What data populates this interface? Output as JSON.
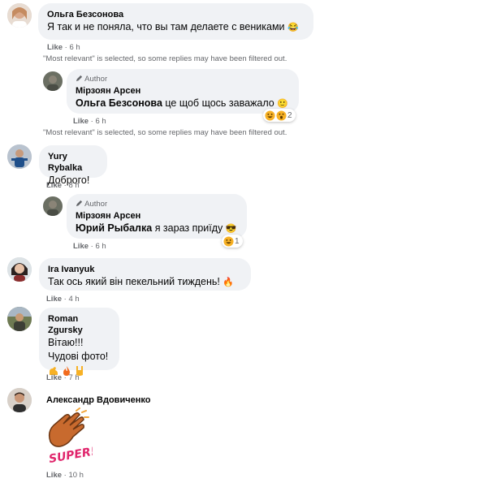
{
  "comments": [
    {
      "name": "Ольга Безсонова",
      "text": "Я так и не поняла, что вы там делаете с вениками",
      "emoji": "😂",
      "like": "Like",
      "time": "6 h"
    },
    {
      "note": "\"Most relevant\" is selected, so some replies may have been filtered out."
    },
    {
      "author_badge": "Author",
      "name": "Мірзоян Арсен",
      "mention": "Ольга Безсонова",
      "text": "це щоб щось заважало",
      "emoji": "🙂",
      "reaction_count": "2",
      "like": "Like",
      "time": "6 h"
    },
    {
      "note": "\"Most relevant\" is selected, so some replies may have been filtered out."
    },
    {
      "name": "Yury Rybalka",
      "text": "Доброго!",
      "like": "Like",
      "time": "8 h"
    },
    {
      "author_badge": "Author",
      "name": "Мірзоян Арсен",
      "mention": "Юрий Рыбалка",
      "text": "я зараз приїду",
      "emoji": "😎",
      "reaction_count": "1",
      "like": "Like",
      "time": "6 h"
    },
    {
      "name": "Ira Ivanyuk",
      "text": "Так ось який він пекельний тиждень!",
      "emoji": "🔥",
      "like": "Like",
      "time": "4 h"
    },
    {
      "name": "Roman Zgursky",
      "line1": "Вітаю!!!",
      "line2": "Чудові фото!",
      "like": "Like",
      "time": "7 h"
    },
    {
      "name": "Александр Вдовиченко",
      "sticker_text": "SUPER!",
      "like": "Like",
      "time": "10 h"
    }
  ],
  "colors": {
    "bubble": "#f0f2f5",
    "secondary_text": "#65676b",
    "primary_text": "#050505",
    "haha": "#f7b125",
    "wow": "#1877f2"
  },
  "icons": {
    "author": "pencil-icon",
    "haha": "haha-reaction-icon",
    "like": "like-reaction-icon"
  }
}
